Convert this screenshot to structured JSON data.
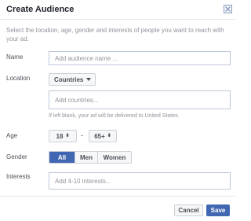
{
  "dialog": {
    "title": "Create Audience",
    "close_icon": "close-x-icon",
    "intro": "Select the location, age, gender and interests of people you want to reach with your ad."
  },
  "name": {
    "label": "Name",
    "placeholder": "Add audience name ..."
  },
  "location": {
    "label": "Location",
    "type_value": "Countries",
    "countries_placeholder": "Add countries...",
    "helper": "If left blank, your ad will be delivered to United States."
  },
  "age": {
    "label": "Age",
    "min": "18",
    "separator": "-",
    "max": "65+"
  },
  "gender": {
    "label": "Gender",
    "options": [
      "All",
      "Men",
      "Women"
    ],
    "selected": "All"
  },
  "interests": {
    "label": "Interests",
    "placeholder": "Add 4-10 interests..."
  },
  "footer": {
    "cancel_label": "Cancel",
    "save_label": "Save"
  },
  "colors": {
    "accent": "#4267b2",
    "border": "#bdc7d8",
    "muted_text": "#90949c"
  }
}
